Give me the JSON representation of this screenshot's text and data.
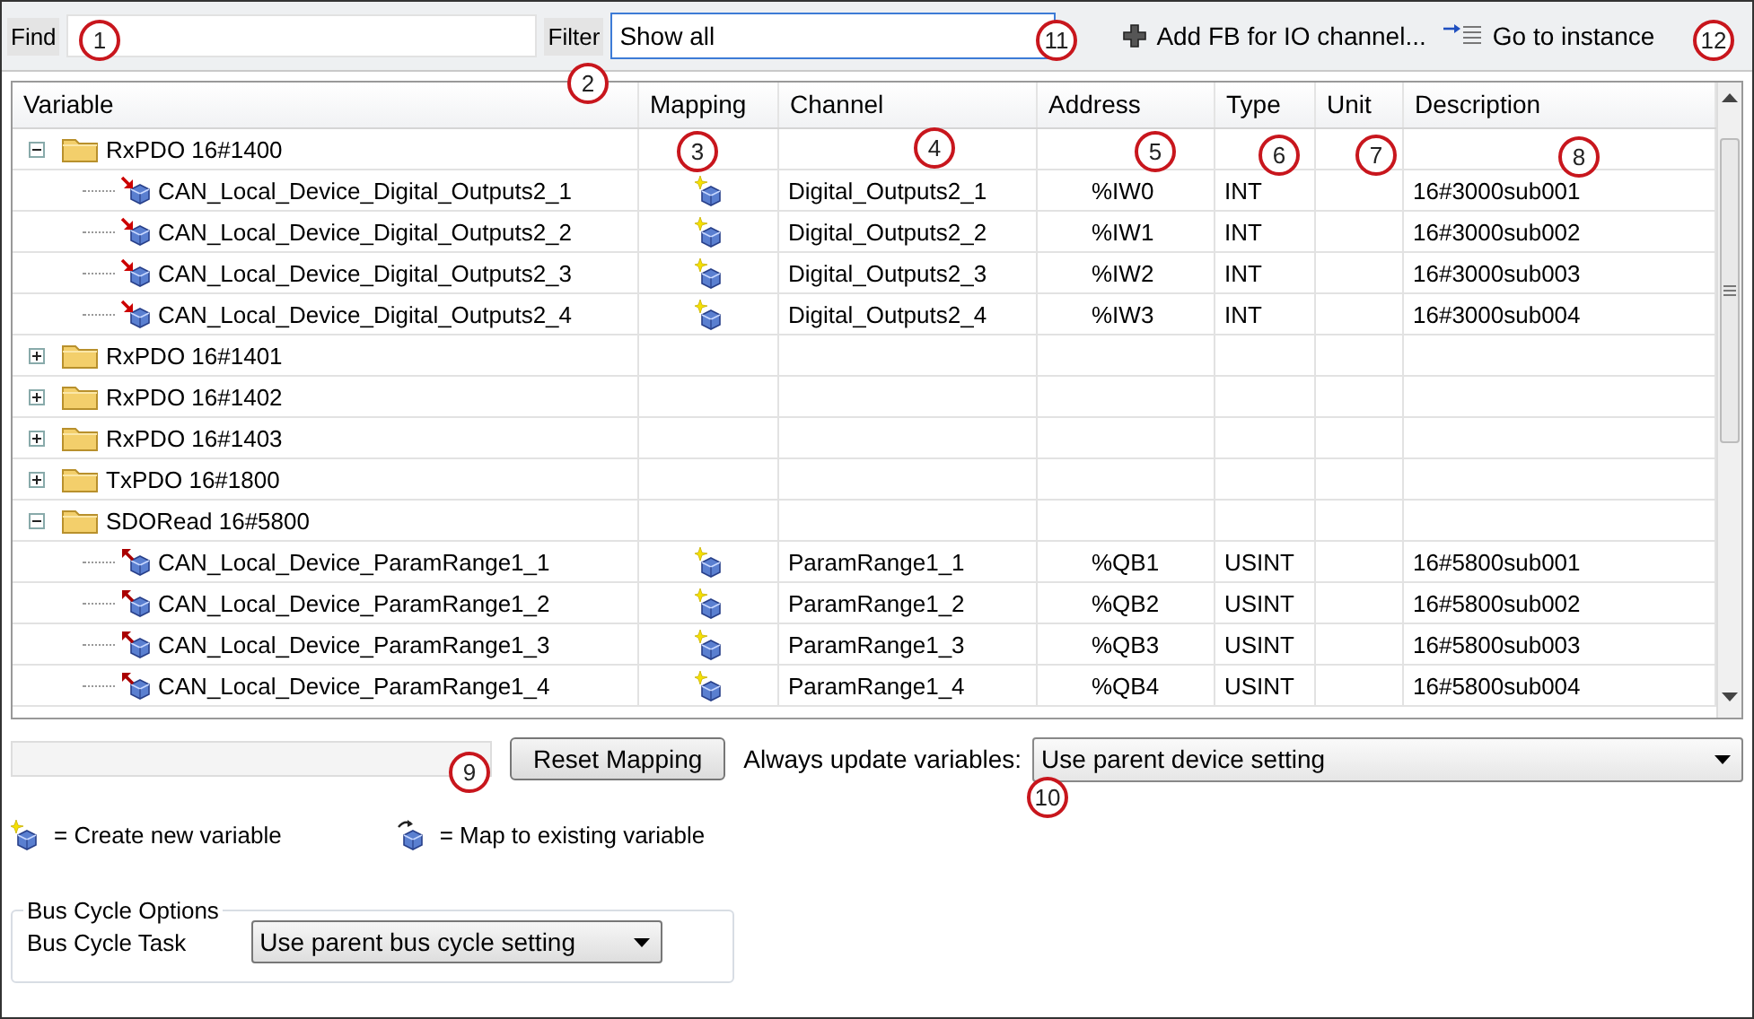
{
  "toolbar": {
    "find_label": "Find",
    "filter_label": "Filter",
    "filter_value": "Show all",
    "add_fb_button": "Add FB for IO channel...",
    "go_to_instance_button": "Go to instance"
  },
  "table": {
    "columns": [
      "Variable",
      "Mapping",
      "Channel",
      "Address",
      "Type",
      "Unit",
      "Description"
    ],
    "rows": [
      {
        "label": "RxPDO 16#1400",
        "expanded": true,
        "children": [
          {
            "variable": "CAN_Local_Device_Digital_Outputs2_1",
            "kind": "output",
            "channel": "Digital_Outputs2_1",
            "address": "%IW0",
            "type": "INT",
            "description": "16#3000sub001"
          },
          {
            "variable": "CAN_Local_Device_Digital_Outputs2_2",
            "kind": "output",
            "channel": "Digital_Outputs2_2",
            "address": "%IW1",
            "type": "INT",
            "description": "16#3000sub002"
          },
          {
            "variable": "CAN_Local_Device_Digital_Outputs2_3",
            "kind": "output",
            "channel": "Digital_Outputs2_3",
            "address": "%IW2",
            "type": "INT",
            "description": "16#3000sub003"
          },
          {
            "variable": "CAN_Local_Device_Digital_Outputs2_4",
            "kind": "output",
            "channel": "Digital_Outputs2_4",
            "address": "%IW3",
            "type": "INT",
            "description": "16#3000sub004"
          }
        ]
      },
      {
        "label": "RxPDO 16#1401",
        "expanded": false
      },
      {
        "label": "RxPDO 16#1402",
        "expanded": false
      },
      {
        "label": "RxPDO 16#1403",
        "expanded": false
      },
      {
        "label": "TxPDO 16#1800",
        "expanded": false
      },
      {
        "label": "SDORead 16#5800",
        "expanded": true,
        "children": [
          {
            "variable": "CAN_Local_Device_ParamRange1_1",
            "kind": "input",
            "channel": "ParamRange1_1",
            "address": "%QB1",
            "type": "USINT",
            "description": "16#5800sub001"
          },
          {
            "variable": "CAN_Local_Device_ParamRange1_2",
            "kind": "input",
            "channel": "ParamRange1_2",
            "address": "%QB2",
            "type": "USINT",
            "description": "16#5800sub002"
          },
          {
            "variable": "CAN_Local_Device_ParamRange1_3",
            "kind": "input",
            "channel": "ParamRange1_3",
            "address": "%QB3",
            "type": "USINT",
            "description": "16#5800sub003"
          },
          {
            "variable": "CAN_Local_Device_ParamRange1_4",
            "kind": "input",
            "channel": "ParamRange1_4",
            "address": "%QB4",
            "type": "USINT",
            "description": "16#5800sub004"
          }
        ]
      }
    ]
  },
  "footer": {
    "reset_button": "Reset Mapping",
    "update_label": "Always update variables:",
    "update_value": "Use parent device setting"
  },
  "legend": [
    {
      "kind": "new",
      "text": "= Create new variable"
    },
    {
      "kind": "existing",
      "text": "= Map to existing variable"
    }
  ],
  "bus_cycle": {
    "title": "Bus Cycle Options",
    "label": "Bus Cycle Task",
    "value": "Use parent bus cycle setting"
  },
  "callouts": [
    "1",
    "2",
    "3",
    "4",
    "5",
    "6",
    "7",
    "8",
    "9",
    "10",
    "11",
    "12"
  ]
}
